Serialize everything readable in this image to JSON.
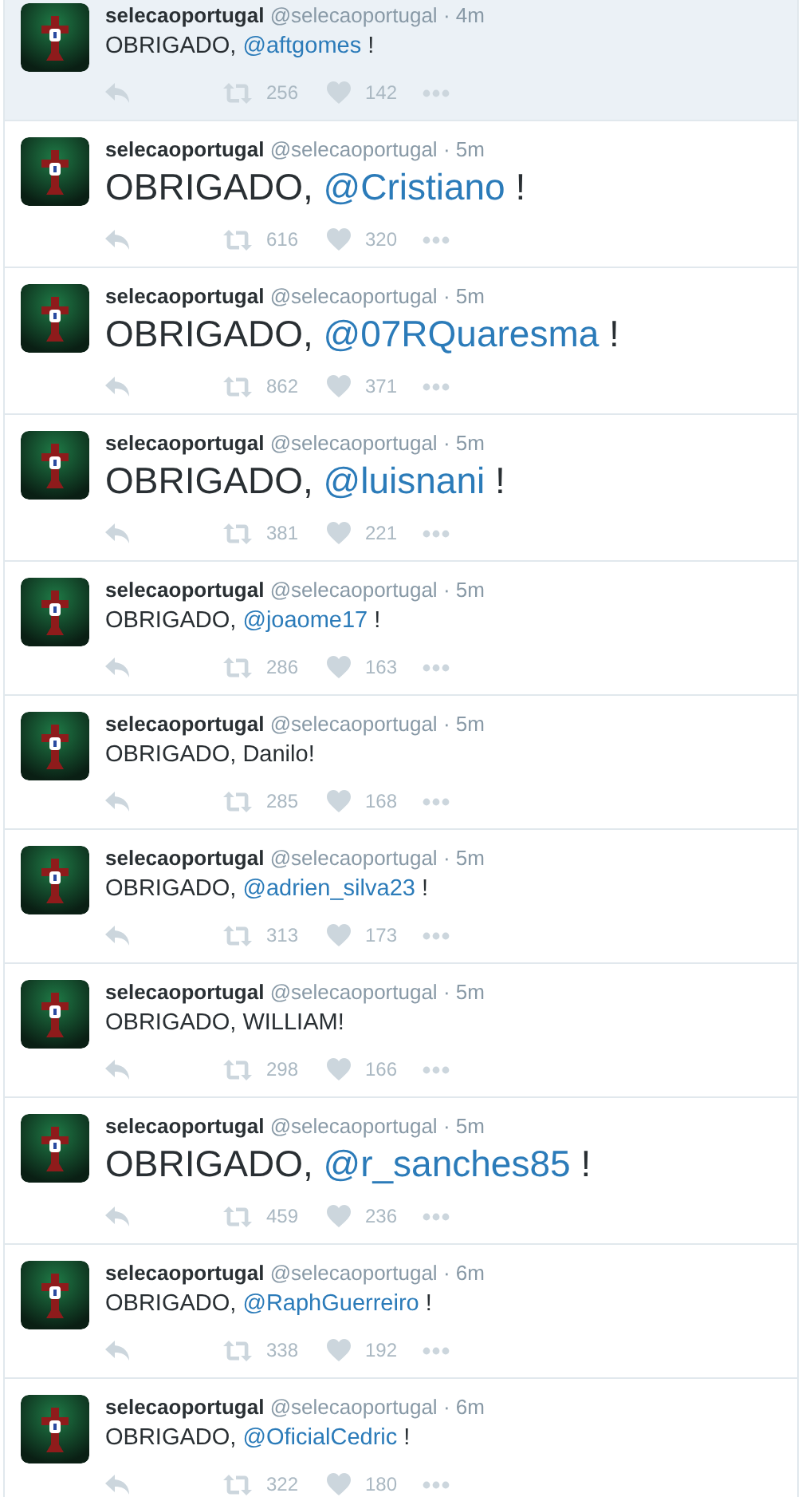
{
  "tweets": [
    {
      "name": "selecaoportugal",
      "handle": "@selecaoportugal",
      "separator": "·",
      "time": "4m",
      "kind": "normal",
      "highlighted": true,
      "text": [
        {
          "kind": "plain",
          "text": "OBRIGADO, "
        },
        {
          "kind": "mention",
          "text": "@aftgomes"
        },
        {
          "kind": "plain",
          "text": " !"
        }
      ],
      "retweets": "256",
      "likes": "142"
    },
    {
      "name": "selecaoportugal",
      "handle": "@selecaoportugal",
      "separator": "·",
      "time": "5m",
      "kind": "large",
      "highlighted": false,
      "text": [
        {
          "kind": "plain",
          "text": "OBRIGADO, "
        },
        {
          "kind": "mention",
          "text": "@Cristiano"
        },
        {
          "kind": "plain",
          "text": " !"
        }
      ],
      "retweets": "616",
      "likes": "320"
    },
    {
      "name": "selecaoportugal",
      "handle": "@selecaoportugal",
      "separator": "·",
      "time": "5m",
      "kind": "large",
      "highlighted": false,
      "text": [
        {
          "kind": "plain",
          "text": "OBRIGADO, "
        },
        {
          "kind": "mention",
          "text": "@07RQuaresma"
        },
        {
          "kind": "plain",
          "text": " !"
        }
      ],
      "retweets": "862",
      "likes": "371"
    },
    {
      "name": "selecaoportugal",
      "handle": "@selecaoportugal",
      "separator": "·",
      "time": "5m",
      "kind": "large",
      "highlighted": false,
      "text": [
        {
          "kind": "plain",
          "text": "OBRIGADO, "
        },
        {
          "kind": "mention",
          "text": "@luisnani"
        },
        {
          "kind": "plain",
          "text": " !"
        }
      ],
      "retweets": "381",
      "likes": "221"
    },
    {
      "name": "selecaoportugal",
      "handle": "@selecaoportugal",
      "separator": "·",
      "time": "5m",
      "kind": "normal",
      "highlighted": false,
      "text": [
        {
          "kind": "plain",
          "text": "OBRIGADO, "
        },
        {
          "kind": "mention",
          "text": "@joaome17"
        },
        {
          "kind": "plain",
          "text": " !"
        }
      ],
      "retweets": "286",
      "likes": "163"
    },
    {
      "name": "selecaoportugal",
      "handle": "@selecaoportugal",
      "separator": "·",
      "time": "5m",
      "kind": "normal",
      "highlighted": false,
      "text": [
        {
          "kind": "plain",
          "text": "OBRIGADO, Danilo!"
        }
      ],
      "retweets": "285",
      "likes": "168"
    },
    {
      "name": "selecaoportugal",
      "handle": "@selecaoportugal",
      "separator": "·",
      "time": "5m",
      "kind": "normal",
      "highlighted": false,
      "text": [
        {
          "kind": "plain",
          "text": "OBRIGADO, "
        },
        {
          "kind": "mention",
          "text": "@adrien_silva23"
        },
        {
          "kind": "plain",
          "text": " !"
        }
      ],
      "retweets": "313",
      "likes": "173"
    },
    {
      "name": "selecaoportugal",
      "handle": "@selecaoportugal",
      "separator": "·",
      "time": "5m",
      "kind": "normal",
      "highlighted": false,
      "text": [
        {
          "kind": "plain",
          "text": "OBRIGADO, WILLIAM!"
        }
      ],
      "retweets": "298",
      "likes": "166"
    },
    {
      "name": "selecaoportugal",
      "handle": "@selecaoportugal",
      "separator": "·",
      "time": "5m",
      "kind": "large",
      "highlighted": false,
      "text": [
        {
          "kind": "plain",
          "text": "OBRIGADO, "
        },
        {
          "kind": "mention",
          "text": "@r_sanches85"
        },
        {
          "kind": "plain",
          "text": " !"
        }
      ],
      "retweets": "459",
      "likes": "236"
    },
    {
      "name": "selecaoportugal",
      "handle": "@selecaoportugal",
      "separator": "·",
      "time": "6m",
      "kind": "normal",
      "highlighted": false,
      "text": [
        {
          "kind": "plain",
          "text": "OBRIGADO, "
        },
        {
          "kind": "mention",
          "text": "@RaphGuerreiro"
        },
        {
          "kind": "plain",
          "text": " !"
        }
      ],
      "retweets": "338",
      "likes": "192"
    },
    {
      "name": "selecaoportugal",
      "handle": "@selecaoportugal",
      "separator": "·",
      "time": "6m",
      "kind": "normal",
      "highlighted": false,
      "text": [
        {
          "kind": "plain",
          "text": "OBRIGADO, "
        },
        {
          "kind": "mention",
          "text": "@OficialCedric"
        },
        {
          "kind": "plain",
          "text": " !"
        }
      ],
      "retweets": "322",
      "likes": "180"
    }
  ]
}
